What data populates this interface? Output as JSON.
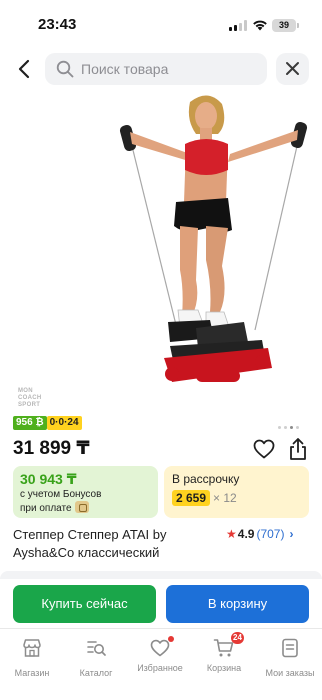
{
  "status": {
    "time": "23:43",
    "battery": "39"
  },
  "header": {
    "search_placeholder": "Поиск товара"
  },
  "image": {
    "watermark_lines": [
      "MON",
      "COACH",
      "SPORT"
    ]
  },
  "badges": {
    "bonus": "956 ₿",
    "installment_label": "0·0·24"
  },
  "price": "31 899 ₸",
  "bonus_card": {
    "price": "30 943 ₸",
    "note_line1": "с учетом Бонусов",
    "note_line2": "при оплате"
  },
  "installment_card": {
    "title": "В рассрочку",
    "amount": "2 659",
    "count": "× 12"
  },
  "product": {
    "title": "Степпер Степпер ATAI by Aysha&Co классический",
    "rating": "4.9",
    "reviews": "(707)"
  },
  "actions": {
    "buy_now": "Купить сейчас",
    "add_to_cart": "В корзину"
  },
  "tabbar": {
    "items": [
      {
        "label": "Магазин",
        "icon": "shop-icon"
      },
      {
        "label": "Каталог",
        "icon": "catalog-icon"
      },
      {
        "label": "Избранное",
        "icon": "heart-icon"
      },
      {
        "label": "Корзина",
        "icon": "cart-icon",
        "badge": "24"
      },
      {
        "label": "Мои заказы",
        "icon": "orders-icon"
      }
    ]
  },
  "colors": {
    "green": "#1aa64a",
    "blue": "#1d70d8",
    "red": "#e53935",
    "yellow": "#ffd21f"
  }
}
